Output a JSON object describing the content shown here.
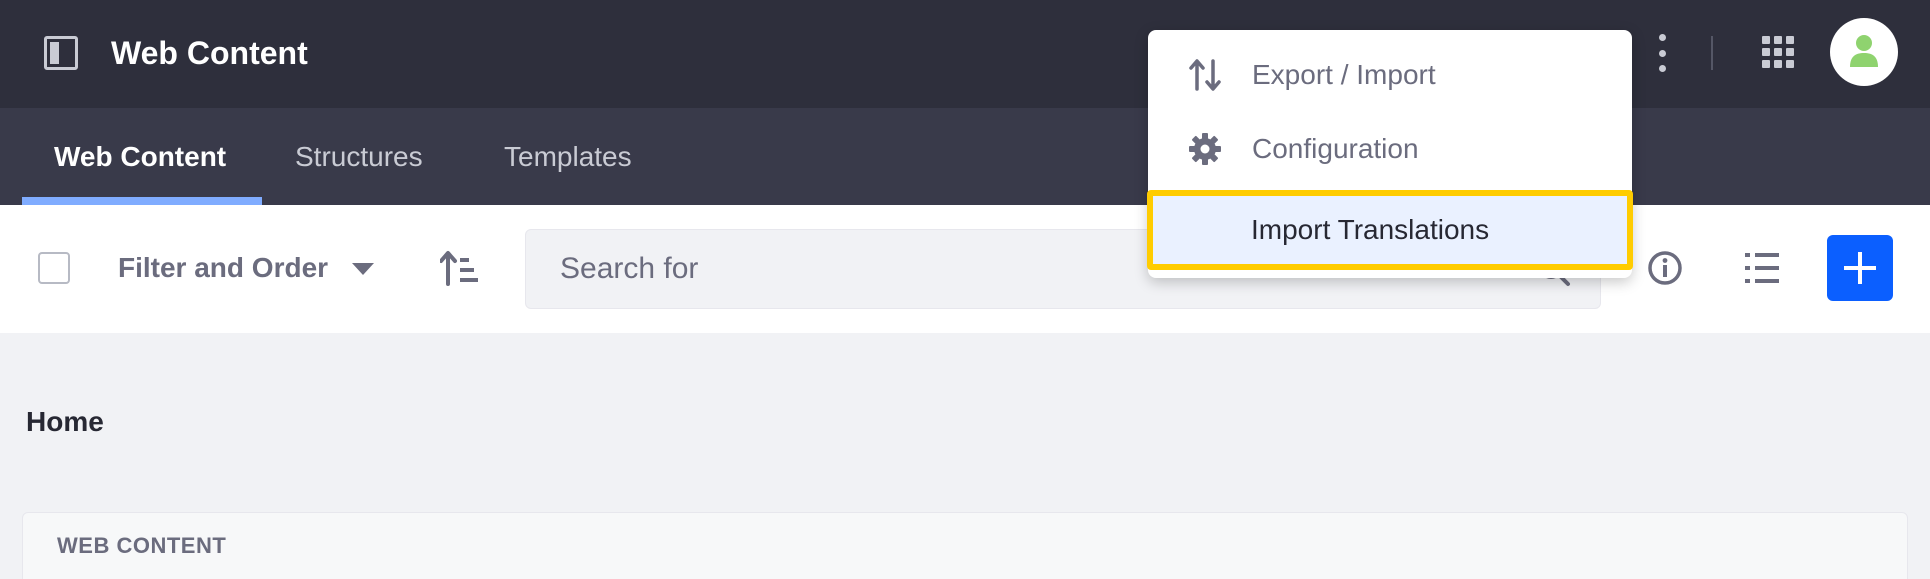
{
  "app": {
    "title": "Web Content"
  },
  "tabs": [
    {
      "label": "Web Content",
      "active": true
    },
    {
      "label": "Structures",
      "active": false
    },
    {
      "label": "Templates",
      "active": false
    }
  ],
  "toolbar": {
    "filter_label": "Filter and Order",
    "search_placeholder": "Search for"
  },
  "breadcrumb": {
    "home": "Home"
  },
  "panel": {
    "header": "WEB CONTENT"
  },
  "menu": {
    "items": [
      {
        "label": "Export / Import",
        "icon": "import-export-icon"
      },
      {
        "label": "Configuration",
        "icon": "gear-icon"
      },
      {
        "label": "Import Translations",
        "icon": "",
        "highlighted": true
      }
    ]
  },
  "colors": {
    "app_bar": "#2e2f3c",
    "tabs_bar": "#393a4a",
    "active_tab_underline": "#80acff",
    "primary_button": "#0b5fff",
    "highlight_outline": "#ffcc00",
    "avatar_figure": "#8fd36f"
  }
}
